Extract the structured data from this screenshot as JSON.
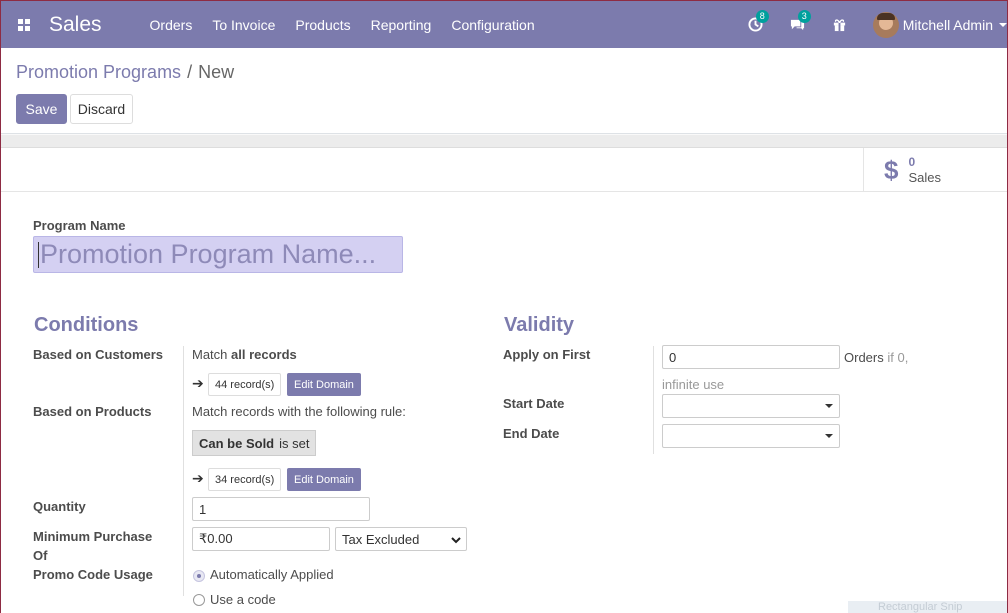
{
  "navbar": {
    "brand": "Sales",
    "menu": [
      "Orders",
      "To Invoice",
      "Products",
      "Reporting",
      "Configuration"
    ],
    "activity_count": "8",
    "messages_count": "3",
    "user": "Mitchell Admin",
    "color": "#7c7bad"
  },
  "breadcrumb": {
    "parent": "Promotion Programs",
    "separator": "/",
    "current": "New"
  },
  "buttons": {
    "save": "Save",
    "discard": "Discard"
  },
  "stat": {
    "value": "0",
    "label": "Sales",
    "icon": "$"
  },
  "form": {
    "program_name_label": "Program Name",
    "program_name_placeholder": "Promotion Program Name...",
    "conditions": {
      "title": "Conditions",
      "customers_label": "Based on Customers",
      "customers_match_prefix": "Match",
      "customers_match_bold": "all records",
      "customers_records": "44 record(s)",
      "edit_domain": "Edit Domain",
      "products_label": "Based on Products",
      "products_rule": "Match records with the following rule:",
      "domain_field": "Can be Sold",
      "domain_op": "is set",
      "products_records": "34 record(s)",
      "quantity_label": "Quantity",
      "quantity_value": "1",
      "min_purchase_label_1": "Minimum Purchase",
      "min_purchase_label_2": "Of",
      "min_purchase_value": "₹0.00",
      "tax_option": "Tax Excluded",
      "promo_code_label": "Promo Code Usage",
      "promo_auto": "Automatically Applied",
      "promo_code": "Use a code"
    },
    "validity": {
      "title": "Validity",
      "apply_label": "Apply on First",
      "apply_value": "0",
      "orders_text": "Orders",
      "orders_hint": "if 0,",
      "infinite_text": "infinite use",
      "start_label": "Start Date",
      "end_label": "End Date"
    }
  },
  "ghost_text": "Rectangular Snip"
}
